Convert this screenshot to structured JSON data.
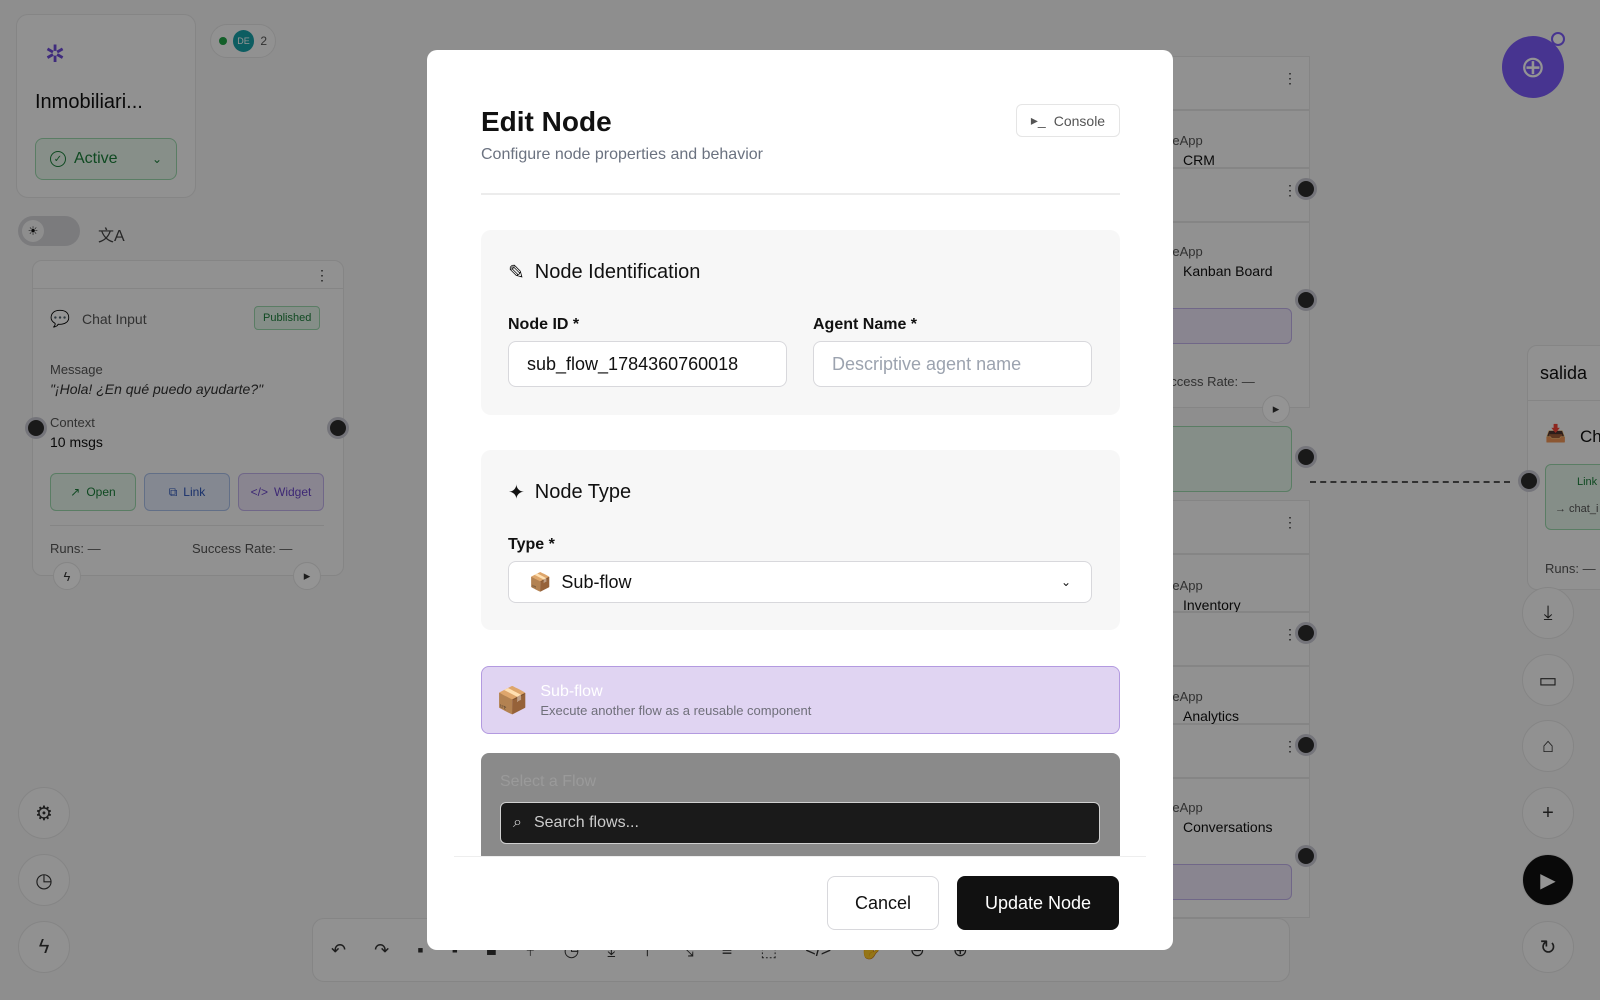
{
  "project": {
    "name": "Inmobiliari...",
    "status": "Active"
  },
  "collab": {
    "avatar_initials": "DE",
    "count": "2"
  },
  "chat_node": {
    "title": "Chat Input",
    "badge": "Published",
    "message_label": "Message",
    "message_value": "\"¡Hola! ¿En qué puedo ayudarte?\"",
    "context_label": "Context",
    "context_value": "10 msgs",
    "buttons": [
      "Open",
      "Link",
      "Widget"
    ],
    "runs": "Runs: —",
    "success": "Success Rate: —"
  },
  "right_nodes": [
    {
      "line1": "iveApp",
      "line2": "CRM"
    },
    {
      "line1": "iveApp",
      "line2": "Kanban Board"
    },
    {
      "line1": "iveApp",
      "line2": "Inventory"
    },
    {
      "line1": "iveApp",
      "line2": "Analytics"
    },
    {
      "line1": "iveApp",
      "line2": "Conversations"
    }
  ],
  "right_success": "uccess Rate: —",
  "salida": {
    "title": "salida",
    "item": "Ch",
    "link": "Link",
    "sub": "→ chat_i",
    "runs": "Runs: —"
  },
  "modal": {
    "title": "Edit Node",
    "subtitle": "Configure node properties and behavior",
    "console_label": "Console",
    "identification": {
      "title": "Node Identification",
      "node_id_label": "Node ID *",
      "node_id_value": "sub_flow_1784360760018",
      "agent_name_label": "Agent Name *",
      "agent_name_placeholder": "Descriptive agent name"
    },
    "node_type": {
      "title": "Node Type",
      "type_label": "Type *",
      "selected": "Sub-flow",
      "selected_icon": "📦"
    },
    "banner": {
      "title": "Sub-flow",
      "description": "Execute another flow as a reusable component",
      "icon": "📦"
    },
    "flow_picker": {
      "label": "Select a Flow",
      "search_placeholder": "Search flows..."
    },
    "cancel_label": "Cancel",
    "submit_label": "Update Node"
  },
  "colors": {
    "accent": "#7a5af8",
    "primary_button": "#111111",
    "active_green": "#1a7f3a"
  }
}
